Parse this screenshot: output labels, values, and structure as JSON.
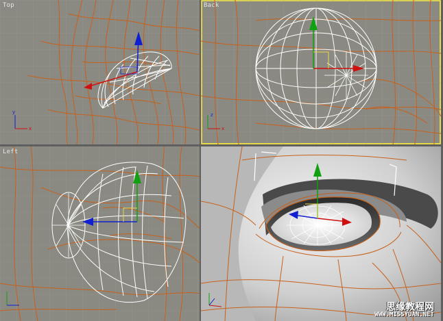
{
  "viewports": {
    "top": {
      "label": "Top"
    },
    "back": {
      "label": "Back"
    },
    "left": {
      "label": "Left"
    },
    "perspective": {
      "label": ""
    }
  },
  "watermark": {
    "title": "思缘教程网",
    "url": "WWW.MISSYUAN.NET"
  },
  "colors": {
    "viewport_bg": "#8a8a83",
    "grid": "#9a9a92",
    "spline": "#c8601a",
    "mesh": "#ffffff",
    "axis_x": "#d01010",
    "axis_y": "#10a010",
    "axis_z": "#1020d0",
    "active_border": "#e8d94a"
  },
  "icons": {
    "gizmo": "transform-gizmo-icon",
    "axis_tripod": "axis-tripod-icon"
  }
}
